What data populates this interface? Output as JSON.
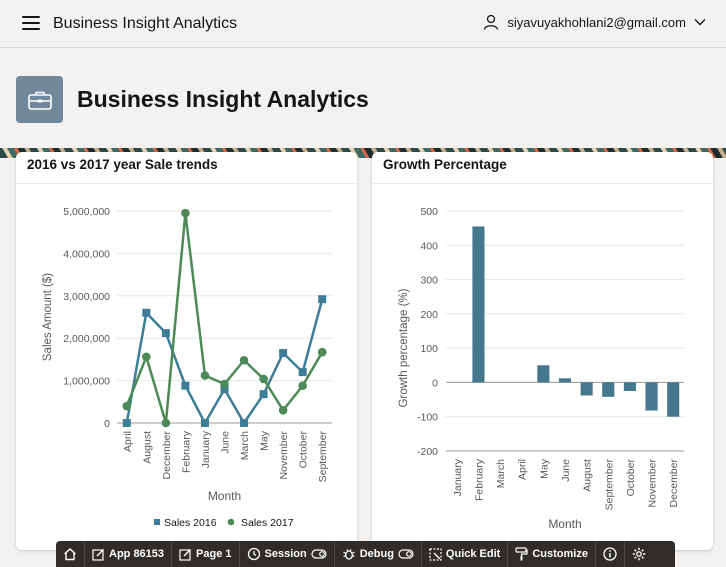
{
  "header": {
    "app_title": "Business Insight Analytics",
    "user_email": "siyavuyakhohlani2@gmail.com"
  },
  "hero": {
    "title": "Business Insight Analytics"
  },
  "cards": {
    "sales_title": "2016 vs 2017 year Sale trends",
    "growth_title": "Growth Percentage"
  },
  "dev_toolbar": {
    "home": "",
    "app": "App 86153",
    "page": "Page 1",
    "session": "Session",
    "debug": "Debug",
    "quick_edit": "Quick Edit",
    "customize": "Customize"
  },
  "colors": {
    "sales_2016": "#3e7d98",
    "sales_2017": "#4d8a57",
    "growth_bar": "#45788f"
  },
  "chart_data": [
    {
      "type": "line",
      "title": "2016 vs 2017 year Sale trends",
      "xlabel": "Month",
      "ylabel": "Sales Amount ($)",
      "categories": [
        "April",
        "August",
        "December",
        "February",
        "January",
        "June",
        "March",
        "May",
        "November",
        "October",
        "September"
      ],
      "yticks": [
        "0",
        "1,000,000",
        "2,000,000",
        "3,000,000",
        "4,000,000",
        "5,000,000"
      ],
      "ylim": [
        0,
        5000000
      ],
      "series": [
        {
          "name": "Sales 2016",
          "marker": "square",
          "values": [
            0,
            2600000,
            2120000,
            880000,
            0,
            800000,
            0,
            680000,
            1650000,
            1200000,
            2920000
          ]
        },
        {
          "name": "Sales 2017",
          "marker": "circle",
          "values": [
            400000,
            1560000,
            0,
            4950000,
            1120000,
            920000,
            1480000,
            1040000,
            300000,
            880000,
            1670000
          ]
        }
      ],
      "legend": "bottom",
      "grid": true
    },
    {
      "type": "bar",
      "title": "Growth Percentage",
      "xlabel": "Month",
      "ylabel": "Growth percentage (%)",
      "categories": [
        "January",
        "February",
        "March",
        "April",
        "May",
        "June",
        "August",
        "September",
        "October",
        "November",
        "December"
      ],
      "values": [
        0,
        455,
        0,
        0,
        50,
        12,
        -38,
        -42,
        -25,
        -82,
        -100
      ],
      "yticks": [
        "500",
        "400",
        "300",
        "200",
        "100",
        "0",
        "-100",
        "-200"
      ],
      "ylim": [
        -200,
        500
      ],
      "grid": true
    }
  ]
}
